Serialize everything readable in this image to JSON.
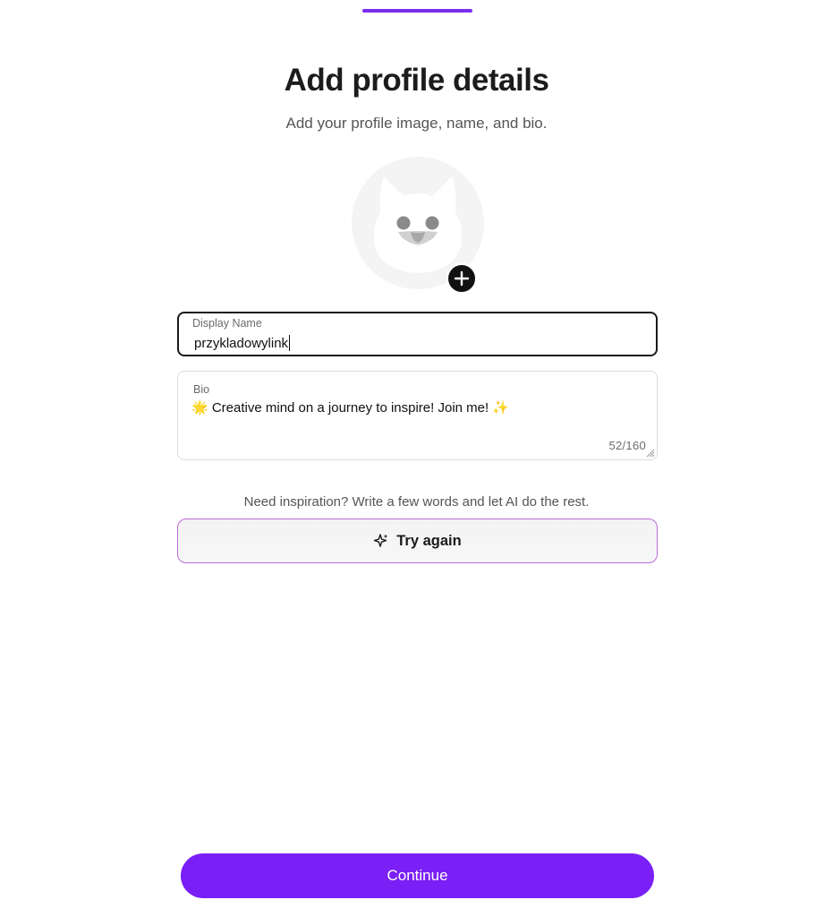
{
  "progress": {
    "percent": 100,
    "color": "#7a2cf0"
  },
  "header": {
    "title": "Add profile details",
    "subtitle": "Add your profile image, name, and bio."
  },
  "avatar": {
    "icon": "cat-avatar-icon",
    "add_icon": "plus-icon"
  },
  "display_name": {
    "label": "Display Name",
    "value": "przykladowylink"
  },
  "bio": {
    "label": "Bio",
    "value": "🌟 Creative mind on a journey to inspire! Join me! ✨",
    "count": "52/160"
  },
  "ai": {
    "hint": "Need inspiration? Write a few words and let AI do the rest.",
    "button_label": "Try again",
    "button_icon": "sparkle-icon"
  },
  "footer": {
    "continue_label": "Continue",
    "accent_color": "#7a1ff5"
  }
}
